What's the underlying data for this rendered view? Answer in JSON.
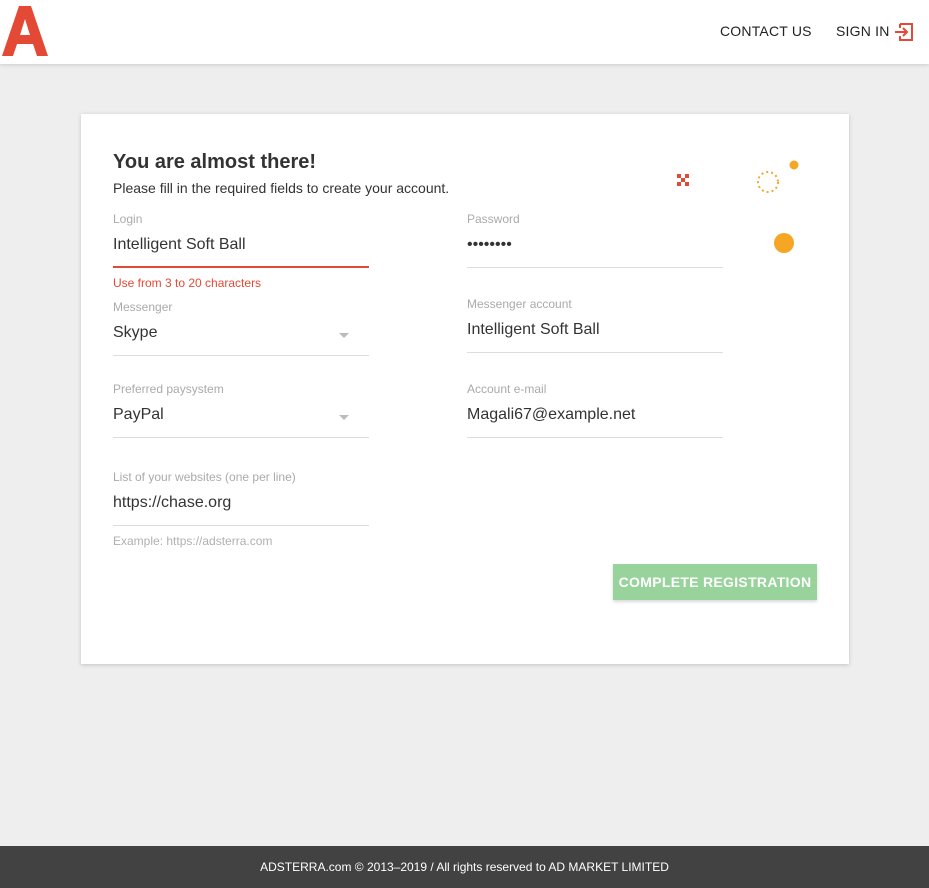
{
  "header": {
    "logo_letter": "A",
    "contact_label": "CONTACT US",
    "signin_label": "SIGN IN"
  },
  "form": {
    "title": "You are almost there!",
    "subtitle": "Please fill in the required fields to create your account.",
    "login": {
      "label": "Login",
      "value": "Intelligent Soft Ball",
      "error": "Use from 3 to 20 characters"
    },
    "password": {
      "label": "Password",
      "value": "••••••••"
    },
    "messenger": {
      "label": "Messenger",
      "value": "Skype"
    },
    "messenger_account": {
      "label": "Messenger account",
      "value": "Intelligent Soft Ball"
    },
    "paysystem": {
      "label": "Preferred paysystem",
      "value": "PayPal"
    },
    "account_email": {
      "label": "Account e-mail",
      "value": "Magali67@example.net"
    },
    "websites": {
      "label": "List of your websites (one per line)",
      "value": "https://chase.org",
      "hint": "Example: https://adsterra.com"
    },
    "submit_label": "COMPLETE REGISTRATION"
  },
  "footer": {
    "text": "ADSTERRA.com © 2013–2019 / All rights reserved to AD MARKET LIMITED"
  },
  "colors": {
    "brand_red": "#e34934",
    "button_green": "#97d39b",
    "accent_orange": "#f5a623",
    "footer_bg": "#424242"
  }
}
